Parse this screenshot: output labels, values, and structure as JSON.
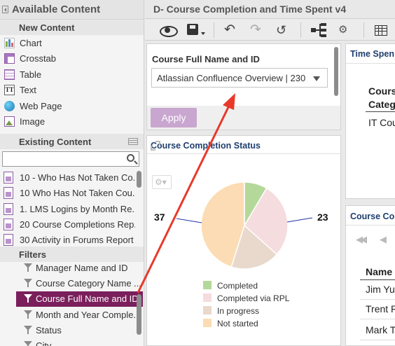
{
  "left_panel": {
    "title": "Available Content",
    "new_content": {
      "header": "New Content",
      "items": [
        {
          "label": "Chart",
          "icon": "chart-icon"
        },
        {
          "label": "Crosstab",
          "icon": "crosstab-icon"
        },
        {
          "label": "Table",
          "icon": "table-icon"
        },
        {
          "label": "Text",
          "icon": "text-icon"
        },
        {
          "label": "Web Page",
          "icon": "web-page-icon"
        },
        {
          "label": "Image",
          "icon": "image-icon"
        }
      ]
    },
    "existing_content": {
      "header": "Existing Content",
      "search_placeholder": "",
      "items": [
        "10 - Who Has Not Taken Co...",
        "10 Who Has Not Taken Cou...",
        "1. LMS Logins by Month Re...",
        "20 Course Completions Rep...",
        "30 Activity in Forums Report"
      ]
    },
    "filters": {
      "header": "Filters",
      "items": [
        "Manager Name and ID",
        "Course Category Name ...",
        "Course Full Name and ID",
        "Month and Year Comple...",
        "Status",
        "City"
      ],
      "selected_index": 2
    }
  },
  "page": {
    "title": "D- Course Completion and Time Spent v4"
  },
  "toolbar": {
    "icons": [
      "view-eye-icon",
      "save-icon",
      "undo-icon",
      "redo-icon",
      "refresh-icon",
      "hierarchy-icon",
      "settings-gear-icon",
      "grid-icon"
    ]
  },
  "filter_panel": {
    "label": "Course Full Name and ID",
    "selected_value": "Atlassian Confluence Overview | 230",
    "apply_label": "Apply"
  },
  "chart_panel": {
    "title": "Course Completion Status"
  },
  "chart_data": {
    "type": "pie",
    "title": "Course Completion Status",
    "slices": [
      {
        "label": "Completed",
        "value": 7,
        "color": "#b4d89a"
      },
      {
        "label": "Completed via RPL",
        "value": 23,
        "color": "#f5dcde"
      },
      {
        "label": "In progress",
        "value": 15,
        "color": "#e8d9cc"
      },
      {
        "label": "Not started",
        "value": 37,
        "color": "#fcdcb4"
      }
    ],
    "data_labels": [
      "37",
      "23"
    ],
    "legend_position": "bottom"
  },
  "right_panels": {
    "time_spent": {
      "title": "Time Spen",
      "column_header_line1": "Cours",
      "column_header_line2": "Categ",
      "first_value": "IT Cou"
    },
    "course_table": {
      "title": "Course Co",
      "column_header": "Name",
      "rows": [
        "Jim Yu",
        "Trent R",
        "Mark T"
      ]
    }
  },
  "colors": {
    "accent": "#7a1f5c",
    "panel_title": "#1f3e6e",
    "apply_button": "#c8a6cf",
    "annotation_arrow": "#e8392b"
  }
}
